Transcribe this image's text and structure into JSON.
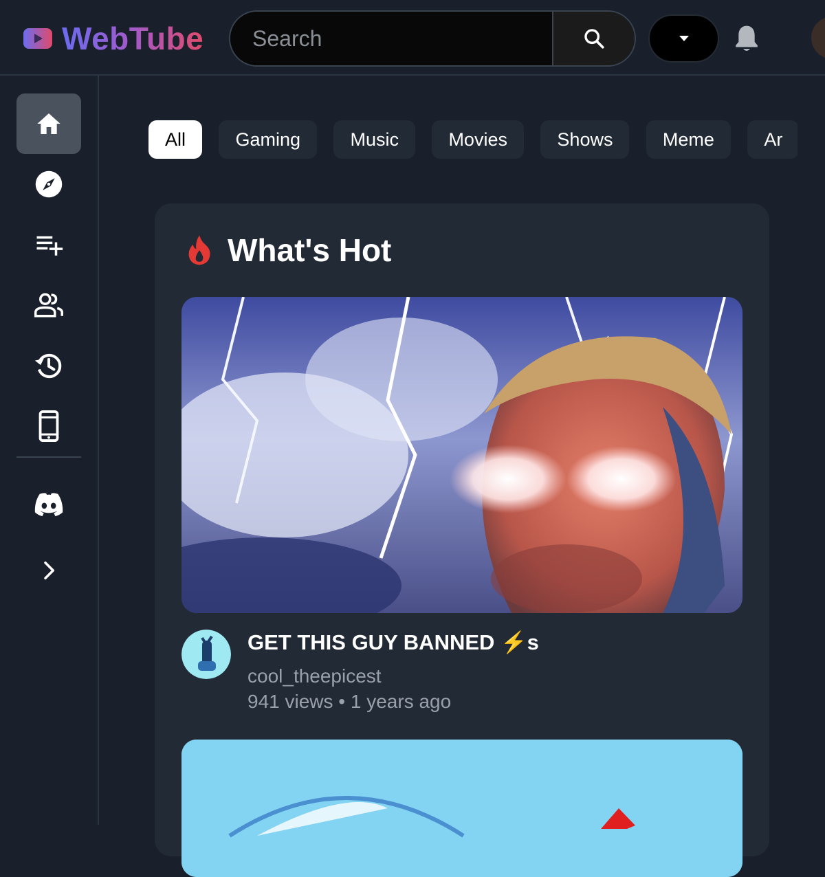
{
  "app": {
    "name": "WebTube",
    "brand_gradient": [
      "#6b6cf0",
      "#a35ac9",
      "#e04b6b"
    ],
    "background": "#19202b"
  },
  "header": {
    "search_placeholder": "Search",
    "icons": [
      "webtube-logo-icon",
      "search-icon",
      "caret-down-icon",
      "bell-icon"
    ]
  },
  "sidebar": {
    "items": [
      {
        "icon": "home-icon",
        "active": true
      },
      {
        "icon": "compass-icon",
        "active": false
      },
      {
        "icon": "playlist-add-icon",
        "active": false
      },
      {
        "icon": "subscriptions-icon",
        "active": false
      },
      {
        "icon": "history-icon",
        "active": false
      },
      {
        "icon": "mobile-icon",
        "active": false
      },
      {
        "icon": "discord-icon",
        "active": false
      },
      {
        "icon": "chevron-right-icon",
        "active": false
      }
    ]
  },
  "chips": [
    {
      "label": "All",
      "active": true
    },
    {
      "label": "Gaming",
      "active": false
    },
    {
      "label": "Music",
      "active": false
    },
    {
      "label": "Movies",
      "active": false
    },
    {
      "label": "Shows",
      "active": false
    },
    {
      "label": "Meme",
      "active": false
    },
    {
      "label": "Ar",
      "active": false
    }
  ],
  "hot": {
    "title": "What's Hot",
    "icon": "fire-icon",
    "accent": "#e53935",
    "videos": [
      {
        "title": "GET THIS GUY BANNED",
        "title_emoji": "⚡",
        "title_suffix": "s",
        "channel": "cool_theepicest",
        "meta": "941 views • 1 years ago"
      }
    ]
  }
}
